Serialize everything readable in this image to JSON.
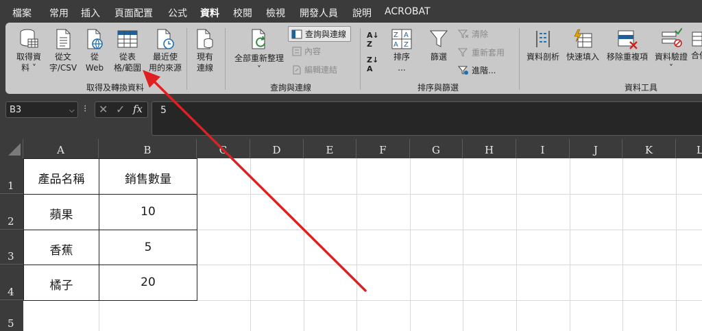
{
  "menu": {
    "tabs": [
      {
        "label": "檔案"
      },
      {
        "label": "常用"
      },
      {
        "label": "插入"
      },
      {
        "label": "頁面配置"
      },
      {
        "label": "公式"
      },
      {
        "label": "資料"
      },
      {
        "label": "校閱"
      },
      {
        "label": "檢視"
      },
      {
        "label": "開發人員"
      },
      {
        "label": "說明"
      },
      {
        "label": "ACROBAT"
      }
    ],
    "active_tab": "資料"
  },
  "ribbon": {
    "get_transform": {
      "get_data_line1": "取得資",
      "get_data_line2": "料",
      "from_text_line1": "從文",
      "from_text_line2": "字/CSV",
      "from_web_line1": "從",
      "from_web_line2": "Web",
      "from_table_line1": "從表",
      "from_table_line2": "格/範圍",
      "recent_line1": "最近使",
      "recent_line2": "用的來源",
      "existing_line1": "現有",
      "existing_line2": "連線",
      "label": "取得及轉換資料"
    },
    "queries": {
      "refresh_all": "全部重新整理",
      "queries_connections": "查詢與連線",
      "properties": "內容",
      "edit_links": "編輯連結",
      "label": "查詢與連線"
    },
    "sort_filter": {
      "sort_line1": "排序",
      "sort_line2": "...",
      "filter": "篩選",
      "clear": "清除",
      "reapply": "重新套用",
      "advanced": "進階...",
      "label": "排序與篩選"
    },
    "data_tools": {
      "text_to_columns": "資料剖析",
      "flash_fill": "快速填入",
      "remove_duplicates": "移除重複項",
      "data_validation": "資料驗證",
      "consolidate": "合併",
      "label": "資料工具"
    }
  },
  "formula_bar": {
    "name_box": "B3",
    "fx_label": "fx",
    "content": "5"
  },
  "sheet": {
    "columns": [
      "A",
      "B",
      "C",
      "D",
      "E",
      "F",
      "G",
      "H",
      "I",
      "J",
      "K",
      "L"
    ],
    "rows": [
      "1",
      "2",
      "3",
      "4",
      "5"
    ],
    "table": {
      "header": [
        "產品名稱",
        "銷售數量"
      ],
      "rows": [
        [
          "蘋果",
          "10"
        ],
        [
          "香蕉",
          "5"
        ],
        [
          "橘子",
          "20"
        ]
      ]
    }
  },
  "colors": {
    "dark_bg": "#3b3b3b",
    "ribbon_bg": "#c9c9c9",
    "active_tab_underline": "#8fd3a0",
    "annotation_arrow": "#e02020"
  },
  "annotation": {
    "type": "arrow",
    "color": "#e02020",
    "points_to": "從表格/範圍"
  }
}
